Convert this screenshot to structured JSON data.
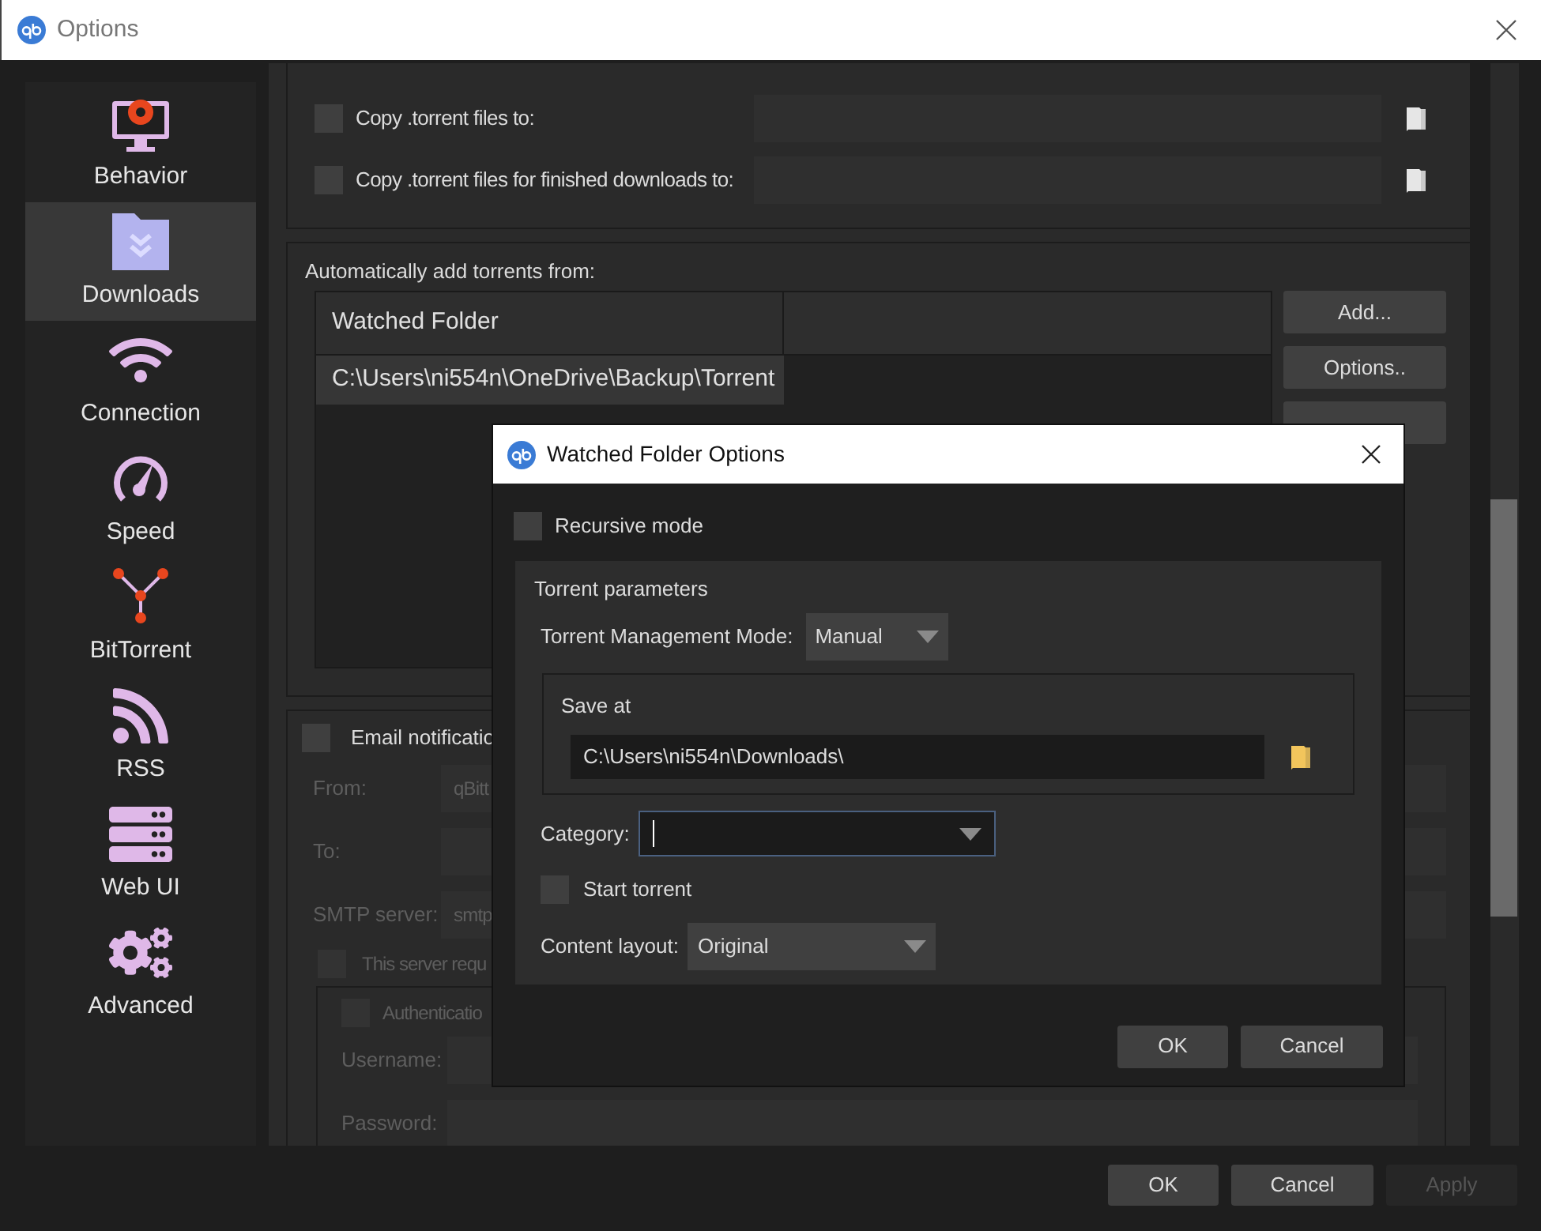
{
  "window": {
    "title": "Options"
  },
  "sidebar": {
    "items": [
      {
        "label": "Behavior",
        "selected": false
      },
      {
        "label": "Downloads",
        "selected": true
      },
      {
        "label": "Connection",
        "selected": false
      },
      {
        "label": "Speed",
        "selected": false
      },
      {
        "label": "BitTorrent",
        "selected": false
      },
      {
        "label": "RSS",
        "selected": false
      },
      {
        "label": "Web UI",
        "selected": false
      },
      {
        "label": "Advanced",
        "selected": false
      }
    ]
  },
  "copy_rows": [
    {
      "label": "Copy .torrent files to:",
      "checked": false
    },
    {
      "label": "Copy .torrent files for finished downloads to:",
      "checked": false
    }
  ],
  "watched": {
    "title": "Automatically add torrents from:",
    "columns": [
      "Watched Folder"
    ],
    "rows": [
      {
        "cells": [
          "C:\\Users\\ni554n\\OneDrive\\Backup\\Torrent"
        ],
        "selected": true
      }
    ],
    "buttons": [
      "Add...",
      "Options.."
    ]
  },
  "email": {
    "label": "Email notificatio",
    "checked": false,
    "fields": [
      {
        "label": "From:",
        "value": "qBitt",
        "disabled": true
      },
      {
        "label": "To:",
        "disabled": true
      },
      {
        "label": "SMTP server:",
        "value": "smtp",
        "disabled": true
      }
    ],
    "requires_auth": {
      "label": "This server requ",
      "checked": false,
      "disabled": true
    },
    "auth": {
      "label": "Authenticatio",
      "checked": false,
      "disabled": true,
      "fields": [
        {
          "label": "Username:",
          "disabled": true
        },
        {
          "label": "Password:",
          "disabled": true
        }
      ]
    }
  },
  "buttons": [
    {
      "label": "OK",
      "disabled": false
    },
    {
      "label": "Cancel",
      "disabled": false
    },
    {
      "label": "Apply",
      "disabled": true
    }
  ],
  "dialog": {
    "title": "Watched Folder Options",
    "recursive": {
      "label": "Recursive mode",
      "checked": false
    },
    "group_title": "Torrent parameters",
    "mode": {
      "label": "Torrent Management Mode:",
      "value": "Manual"
    },
    "save_at": {
      "title": "Save at",
      "path": "C:\\Users\\ni554n\\Downloads\\"
    },
    "category": {
      "label": "Category:"
    },
    "start": {
      "label": "Start torrent",
      "checked": false
    },
    "layout": {
      "label": "Content layout:",
      "value": "Original"
    },
    "buttons": [
      "OK",
      "Cancel"
    ]
  }
}
